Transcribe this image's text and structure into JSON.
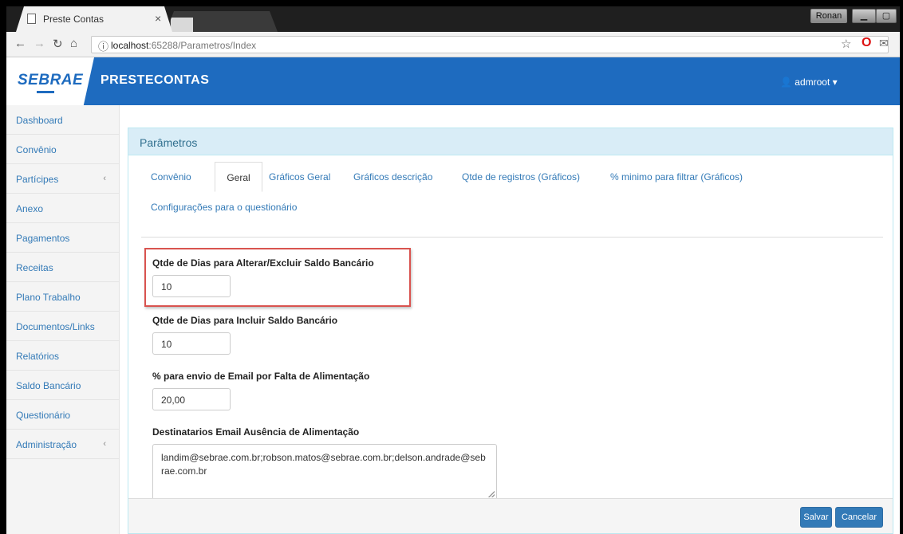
{
  "browser": {
    "tab_title": "Preste Contas",
    "tab_close": "×",
    "window_user": "Ronan",
    "url_host": "localhost",
    "url_path": ":65288/Parametros/Index"
  },
  "app": {
    "logo": "SEBRAE",
    "brand": "PRESTECONTAS",
    "user": "admroot ▾"
  },
  "sidebar": {
    "items": [
      {
        "label": "Dashboard",
        "chev": ""
      },
      {
        "label": "Convênio",
        "chev": ""
      },
      {
        "label": "Partícipes",
        "chev": "‹"
      },
      {
        "label": "Anexo",
        "chev": ""
      },
      {
        "label": "Pagamentos",
        "chev": ""
      },
      {
        "label": "Receitas",
        "chev": ""
      },
      {
        "label": "Plano Trabalho",
        "chev": ""
      },
      {
        "label": "Documentos/Links",
        "chev": ""
      },
      {
        "label": "Relatórios",
        "chev": ""
      },
      {
        "label": "Saldo Bancário",
        "chev": ""
      },
      {
        "label": "Questionário",
        "chev": ""
      },
      {
        "label": "Administração",
        "chev": "‹"
      }
    ]
  },
  "panel": {
    "title": "Parâmetros",
    "tabs": [
      "Convênio",
      "Geral",
      "Gráficos Geral",
      "Gráficos descrição",
      "Qtde de registros (Gráficos)",
      "% minimo para filtrar (Gráficos)",
      "Configurações para o questionário"
    ],
    "fields": {
      "f1_label": "Qtde de Dias para Alterar/Excluir Saldo Bancário",
      "f1_value": "10",
      "f2_label": "Qtde de Dias para Incluir Saldo Bancário",
      "f2_value": "10",
      "f3_label": "% para envio de Email por Falta de Alimentação",
      "f3_value": "20,00",
      "f4_label": "Destinatarios Email Ausência de Alimentação",
      "f4_value": "landim@sebrae.com.br;robson.matos@sebrae.com.br;delson.andrade@sebrae.com.br"
    },
    "buttons": {
      "save": "Salvar",
      "cancel": "Cancelar"
    }
  }
}
